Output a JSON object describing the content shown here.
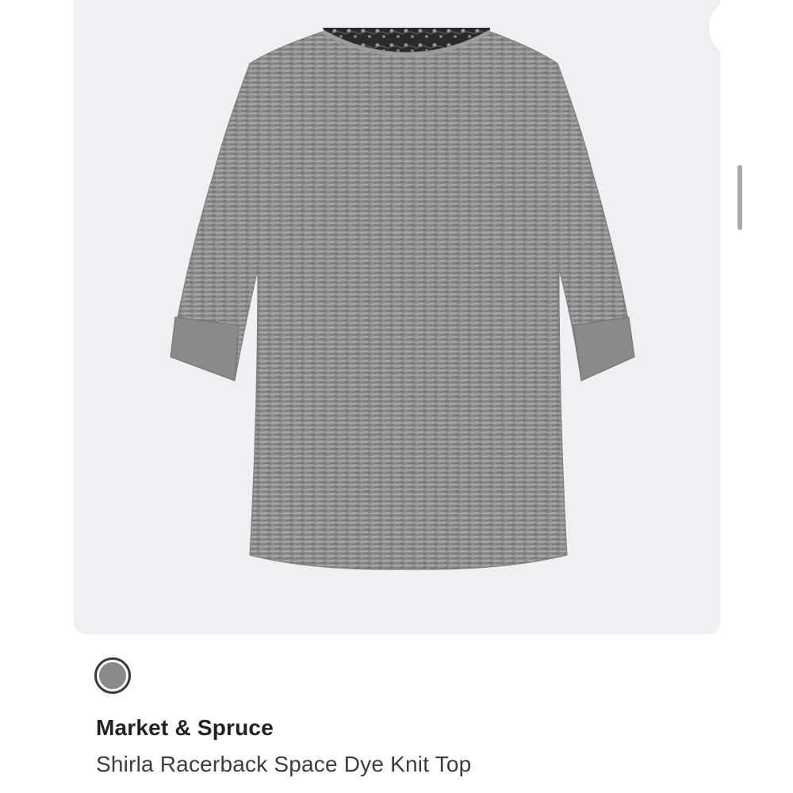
{
  "product": {
    "brand": "Market & Spruce",
    "name": "Shirla Racerback Space Dye Knit Top",
    "image_alt": "gray space dye knit top with black lace racerback",
    "swatch_color": "#8a8a8a"
  },
  "actions": {
    "more_icon": "more-horizontal-icon",
    "more_color": "#1f3a6b"
  },
  "colors": {
    "card_bg": "#eef0f1",
    "garment": "#8c8c8c",
    "lace": "#2b2b2b"
  }
}
